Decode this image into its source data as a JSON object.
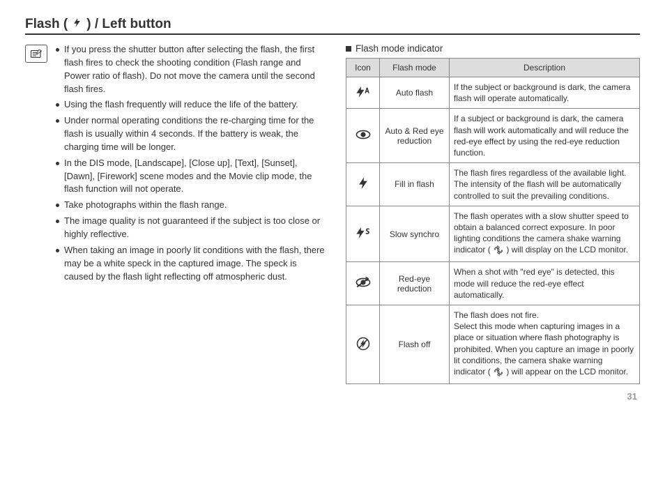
{
  "title": {
    "prefix": "Flash (",
    "suffix": ") / Left button"
  },
  "notes": [
    "If you press the shutter button after selecting the flash, the first flash fires to check the shooting condition (Flash range and Power ratio of flash). Do not move the camera until the second flash fires.",
    "Using the flash frequently will reduce the life of the battery.",
    "Under normal operating conditions the re-charging time for the flash is usually within 4 seconds. If the battery is weak, the charging time will be longer.",
    "In the DIS mode, [Landscape], [Close up], [Text], [Sunset], [Dawn], [Firework] scene modes and the Movie clip mode, the flash function will not operate.",
    "Take photographs within the flash range.",
    "The image quality is not guaranteed if the subject is too close or highly reflective.",
    "When taking an image in poorly lit conditions with the flash, there may be a white speck in the captured image. The speck is caused by the flash light reflecting off atmospheric dust."
  ],
  "table_heading": "Flash mode indicator",
  "table": {
    "headers": {
      "icon": "Icon",
      "mode": "Flash mode",
      "desc": "Description"
    },
    "rows": [
      {
        "icon": "flash-auto-icon",
        "mode": "Auto flash",
        "desc_before": "If the subject or background is dark, the camera flash will operate automatically.",
        "desc_after": ""
      },
      {
        "icon": "auto-redeye-icon",
        "mode": "Auto & Red eye reduction",
        "desc_before": "If a subject or background is dark, the camera flash will work automatically and will reduce the red-eye effect by using the red-eye reduction function.",
        "desc_after": ""
      },
      {
        "icon": "fill-flash-icon",
        "mode": "Fill in flash",
        "desc_before": "The flash fires regardless of the available light. The intensity of the flash will be automatically controlled to suit the prevailing conditions.",
        "desc_after": ""
      },
      {
        "icon": "slow-synchro-icon",
        "mode": "Slow synchro",
        "desc_before": "The flash operates with a slow shutter speed to obtain a balanced correct exposure. In poor lighting conditions the camera shake warning indicator ( ",
        "desc_after": " ) will display on the LCD monitor."
      },
      {
        "icon": "redeye-reduction-icon",
        "mode": "Red-eye reduction",
        "desc_before": "When a shot with \"red eye\" is detected, this mode will reduce the red-eye effect automatically.",
        "desc_after": ""
      },
      {
        "icon": "flash-off-icon",
        "mode": "Flash off",
        "desc_before": "The flash does not fire.\nSelect this mode when capturing images in a place or situation where flash photography is prohibited. When you capture an image in poorly lit conditions, the camera shake warning indicator ( ",
        "desc_after": " ) will appear on the LCD monitor."
      }
    ]
  },
  "page_number": "31"
}
